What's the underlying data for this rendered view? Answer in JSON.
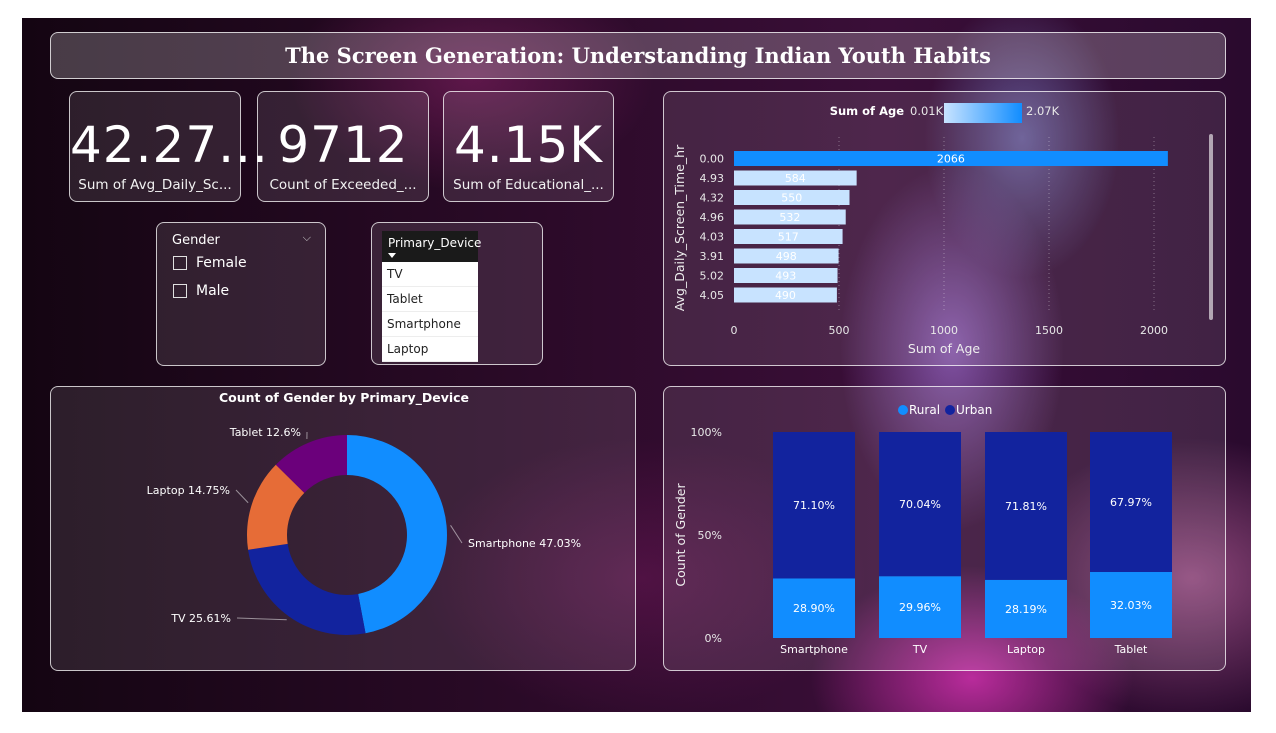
{
  "dashboard": {
    "title": "The Screen Generation: Understanding Indian Youth Habits"
  },
  "kpis": [
    {
      "value": "42.27...",
      "label": "Sum of Avg_Daily_Sc..."
    },
    {
      "value": "9712",
      "label": "Count of Exceeded_..."
    },
    {
      "value": "4.15K",
      "label": "Sum of Educational_..."
    }
  ],
  "gender_slicer": {
    "header": "Gender",
    "options": [
      "Female",
      "Male"
    ]
  },
  "device_slicer": {
    "header": "Primary_Device",
    "options": [
      "TV",
      "Tablet",
      "Smartphone",
      "Laptop"
    ]
  },
  "chart_data": [
    {
      "type": "bar",
      "orientation": "horizontal",
      "legend": {
        "title": "Sum of Age",
        "min_label": "0.01K",
        "max_label": "2.07K"
      },
      "ylabel": "Avg_Daily_Screen_Time_hr",
      "xlabel": "Sum of Age",
      "categories": [
        "0.00",
        "4.93",
        "4.32",
        "4.96",
        "4.03",
        "3.91",
        "5.02",
        "4.05"
      ],
      "values": [
        2066,
        584,
        550,
        532,
        517,
        498,
        493,
        490
      ],
      "data_labels": [
        "2066",
        "584",
        "550",
        "532",
        "517",
        "498",
        "493",
        "490"
      ],
      "xticks": [
        "0",
        "500",
        "1000",
        "1500",
        "2000"
      ],
      "xlim": [
        0,
        2100
      ],
      "grid": true,
      "colors": {
        "low": "#c8e3ff",
        "high": "#118dff"
      }
    },
    {
      "type": "pie",
      "title": "Count of Gender by Primary_Device",
      "slices": [
        {
          "label": "Smartphone 47.03%",
          "value": 47.03,
          "color": "#118dff"
        },
        {
          "label": "TV 25.61%",
          "value": 25.61,
          "color": "#12239e"
        },
        {
          "label": "Laptop 14.75%",
          "value": 14.75,
          "color": "#e66c37"
        },
        {
          "label": "Tablet 12.6%",
          "value": 12.6,
          "color": "#6b007b"
        }
      ],
      "donut": true
    },
    {
      "type": "bar",
      "stacked": "100%",
      "legend": [
        "Rural",
        "Urban"
      ],
      "legend_colors": {
        "Rural": "#118dff",
        "Urban": "#12239e"
      },
      "ylabel": "Count of Gender",
      "yticks": [
        "100%",
        "50%",
        "0%"
      ],
      "categories": [
        "Smartphone",
        "TV",
        "Laptop",
        "Tablet"
      ],
      "series": [
        {
          "name": "Rural",
          "values": [
            28.9,
            29.96,
            28.19,
            32.03
          ],
          "labels": [
            "28.90%",
            "29.96%",
            "28.19%",
            "32.03%"
          ]
        },
        {
          "name": "Urban",
          "values": [
            71.1,
            70.04,
            71.81,
            67.97
          ],
          "labels": [
            "71.10%",
            "70.04%",
            "71.81%",
            "67.97%"
          ]
        }
      ]
    }
  ]
}
